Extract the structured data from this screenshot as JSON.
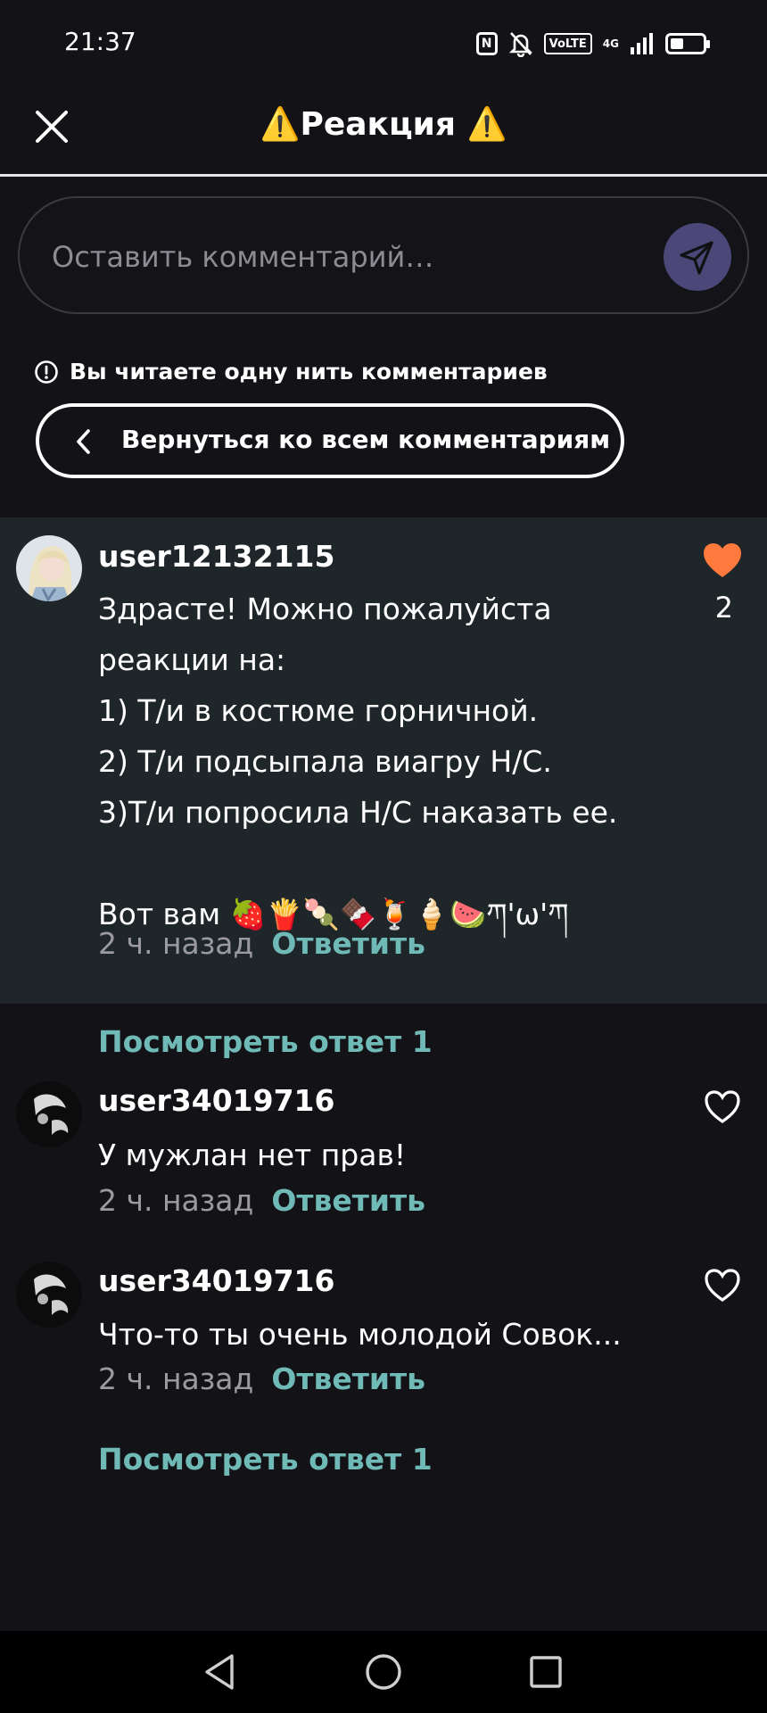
{
  "status_bar": {
    "time": "21:37",
    "icons": [
      "nfc-icon",
      "mute-icon",
      "volte-icon",
      "signal-icon",
      "battery-icon"
    ],
    "volte_label": "VoLTE",
    "network_label": "4G",
    "nfc_label": "N",
    "battery_level": 0.35
  },
  "header": {
    "title": "⚠️Реакция ⚠️"
  },
  "comment_input": {
    "placeholder": "Оставить комментарий…",
    "value": ""
  },
  "thread": {
    "notice": "Вы читаете одну нить комментариев",
    "back_label": "Вернуться ко всем комментариям"
  },
  "comments": [
    {
      "username": "user12132115",
      "text": "Здрасте! Можно пожалуйста\nреакции на:\n1) Т/и в костюме горничной.\n2) Т/и подсыпала виагру Н/С.\n3)Т/и попросила Н/С наказать ее.\n\nВот вам 🍓🍟🍡🍫🍹🍦🍉ཀ'ω'ཀ",
      "time": "2 ч. назад",
      "reply_label": "Ответить",
      "likes": "2",
      "liked": true
    },
    {
      "username": "user34019716",
      "text": "У мужлан нет прав!",
      "time": "2 ч. назад",
      "reply_label": "Ответить",
      "liked": false
    },
    {
      "username": "user34019716",
      "text": "Что-то ты очень молодой Совок...",
      "time": "2 ч. назад",
      "reply_label": "Ответить",
      "liked": false
    }
  ],
  "view_replies": [
    "Посмотреть ответ 1",
    "Посмотреть ответ 1"
  ],
  "colors": {
    "background": "#131317",
    "highlight": "#1e2629",
    "accent": "#6fb9b6",
    "like": "#ff7a3c",
    "send_button": "#4b4778"
  },
  "nav_bar": {
    "icons": [
      "back-icon",
      "home-icon",
      "recents-icon"
    ]
  }
}
